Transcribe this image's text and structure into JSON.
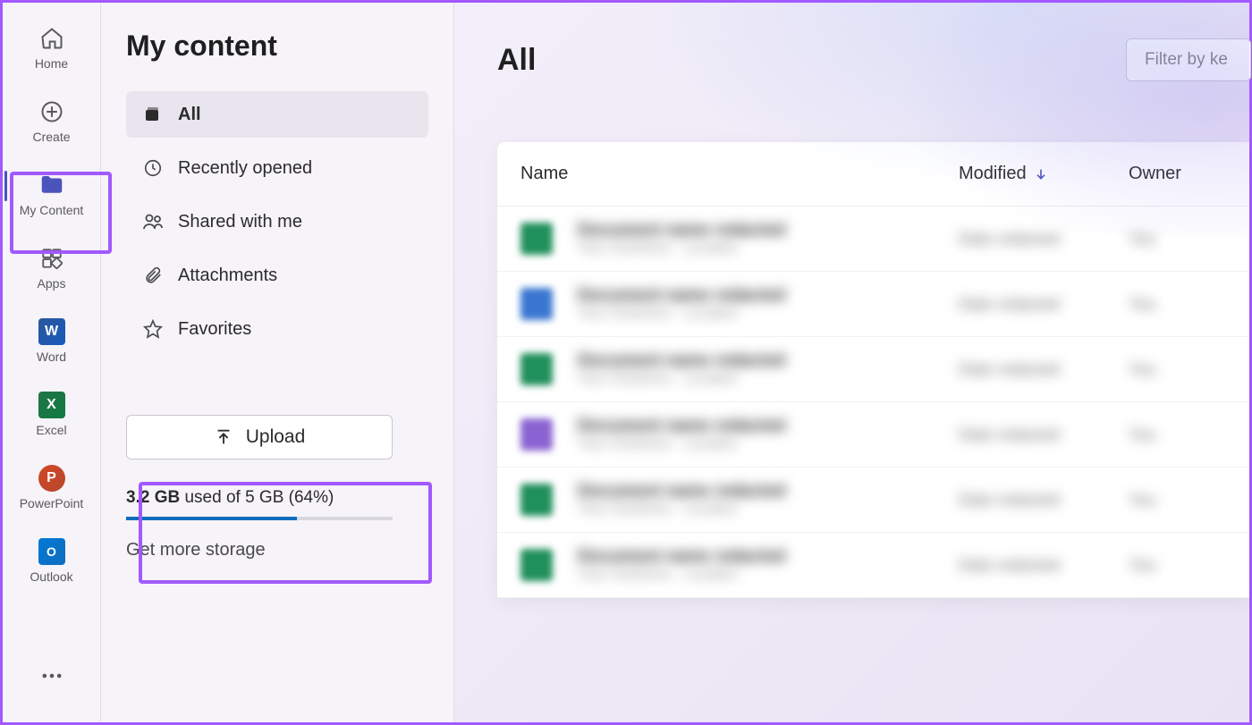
{
  "nav": {
    "items": [
      {
        "label": "Home"
      },
      {
        "label": "Create"
      },
      {
        "label": "My Content"
      },
      {
        "label": "Apps"
      },
      {
        "label": "Word"
      },
      {
        "label": "Excel"
      },
      {
        "label": "PowerPoint"
      },
      {
        "label": "Outlook"
      }
    ]
  },
  "panel": {
    "title": "My content",
    "filters": [
      {
        "label": "All"
      },
      {
        "label": "Recently opened"
      },
      {
        "label": "Shared with me"
      },
      {
        "label": "Attachments"
      },
      {
        "label": "Favorites"
      }
    ],
    "upload_label": "Upload",
    "storage_used": "3.2 GB",
    "storage_rest": " used of 5 GB (64%)",
    "storage_percent": 64,
    "get_more": "Get more storage"
  },
  "main": {
    "heading": "All",
    "filter_placeholder": "Filter by ke",
    "columns": {
      "name": "Name",
      "modified": "Modified",
      "owner": "Owner"
    },
    "rows": [
      {
        "icon_color": "#1f8f5b"
      },
      {
        "icon_color": "#3976d1"
      },
      {
        "icon_color": "#1f8f5b"
      },
      {
        "icon_color": "#8a63d2"
      },
      {
        "icon_color": "#1f8f5b"
      },
      {
        "icon_color": "#1f8f5b"
      }
    ]
  }
}
